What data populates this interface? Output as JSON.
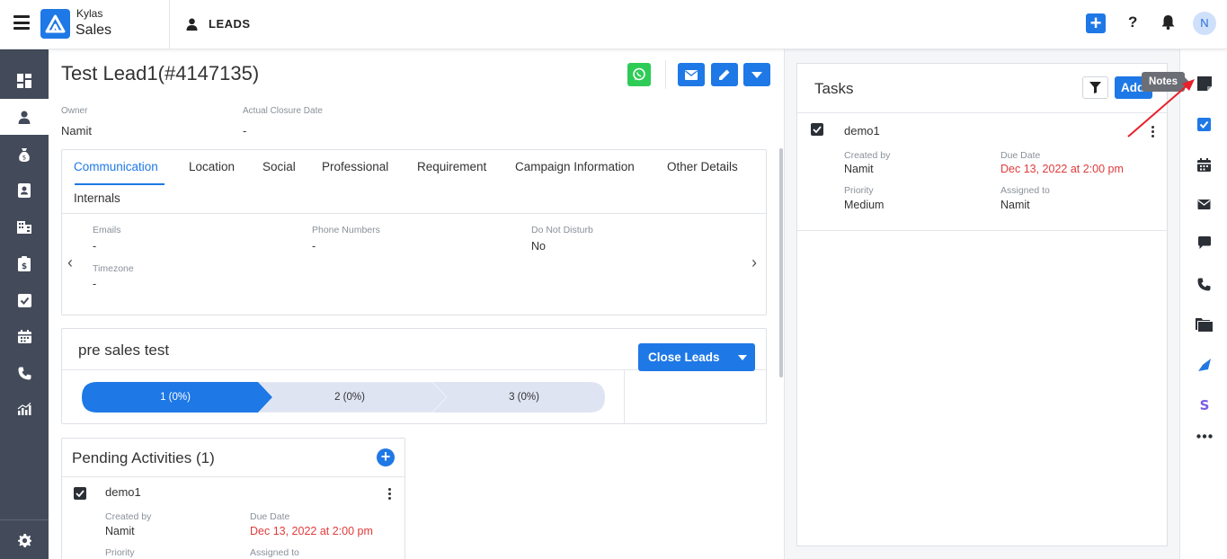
{
  "header": {
    "brand_small": "Kylas",
    "brand_big": "Sales",
    "module": "LEADS",
    "avatar_initial": "N",
    "help": "?",
    "plus": "+"
  },
  "lead": {
    "title": "Test Lead1(#4147135)",
    "owner_label": "Owner",
    "owner_value": "Namit",
    "closure_label": "Actual Closure Date",
    "closure_value": "-"
  },
  "tabs": [
    "Communication",
    "Location",
    "Social",
    "Professional",
    "Requirement",
    "Campaign Information",
    "Other Details",
    "Internals"
  ],
  "communication": {
    "emails_label": "Emails",
    "emails_value": "-",
    "phones_label": "Phone Numbers",
    "phones_value": "-",
    "dnd_label": "Do Not Disturb",
    "dnd_value": "No",
    "timezone_label": "Timezone",
    "timezone_value": "-"
  },
  "pipeline": {
    "title": "pre sales test",
    "stages": [
      "1 (0%)",
      "2 (0%)",
      "3 (0%)"
    ],
    "close_button": "Close Leads"
  },
  "pending": {
    "title": "Pending Activities (1)",
    "task": {
      "name": "demo1",
      "created_by_label": "Created by",
      "created_by": "Namit",
      "due_label": "Due Date",
      "due": "Dec 13, 2022 at 2:00 pm",
      "priority_label": "Priority",
      "assigned_label": "Assigned to"
    }
  },
  "tasks_panel": {
    "title": "Tasks",
    "add_label": "Add",
    "task": {
      "name": "demo1",
      "created_by_label": "Created by",
      "created_by": "Namit",
      "due_label": "Due Date",
      "due": "Dec 13, 2022 at 2:00 pm",
      "priority_label": "Priority",
      "priority": "Medium",
      "assigned_label": "Assigned to",
      "assigned": "Namit"
    }
  },
  "tooltip": "Notes",
  "colors": {
    "primary": "#1e78e6",
    "sidebar": "#434b5a",
    "due": "#e03b3b",
    "whatsapp": "#2ecc56"
  }
}
